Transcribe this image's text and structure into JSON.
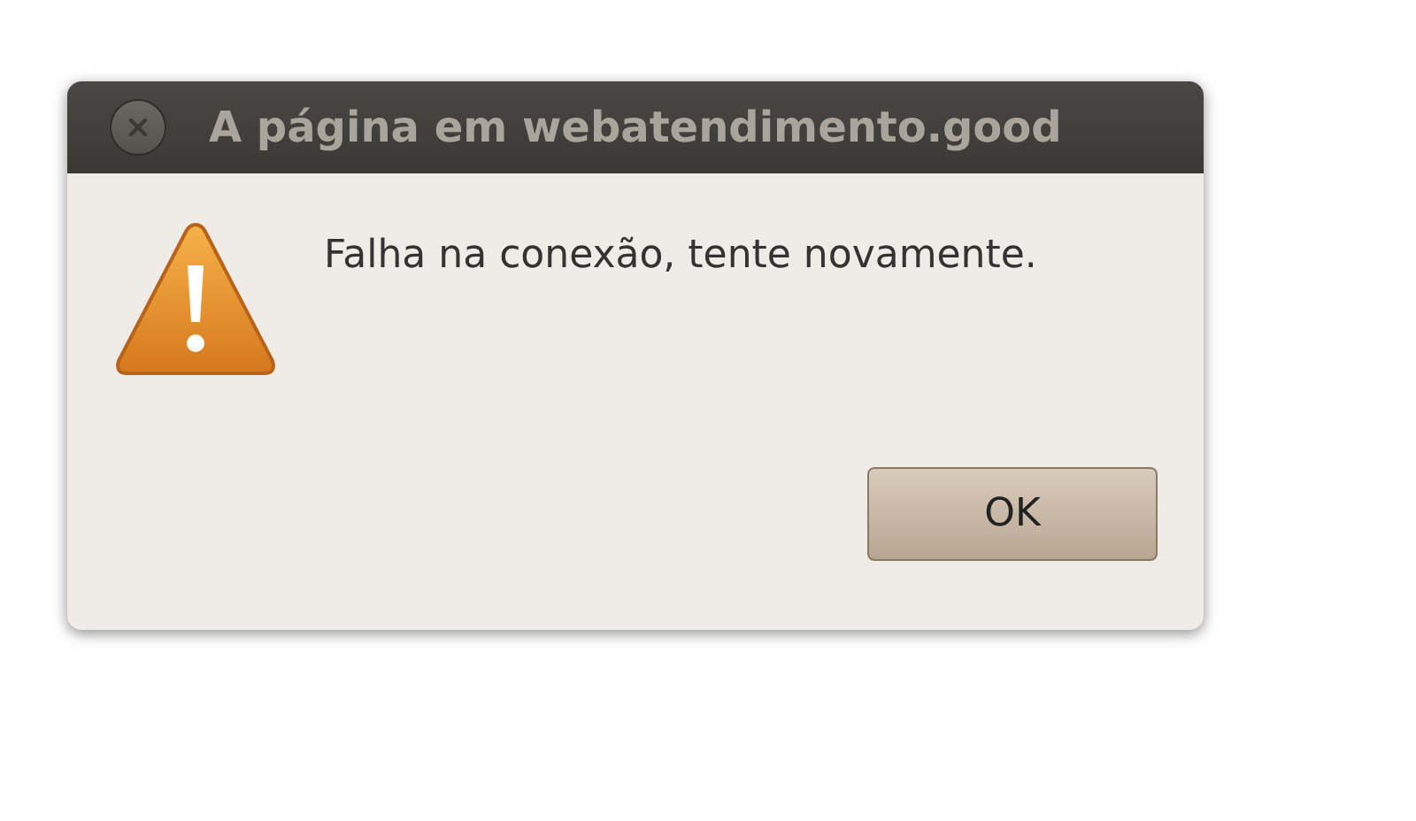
{
  "window": {
    "title": "A página em webatendimento.good"
  },
  "message": "Falha na conexão, tente novamente.",
  "buttons": [
    "OK"
  ]
}
